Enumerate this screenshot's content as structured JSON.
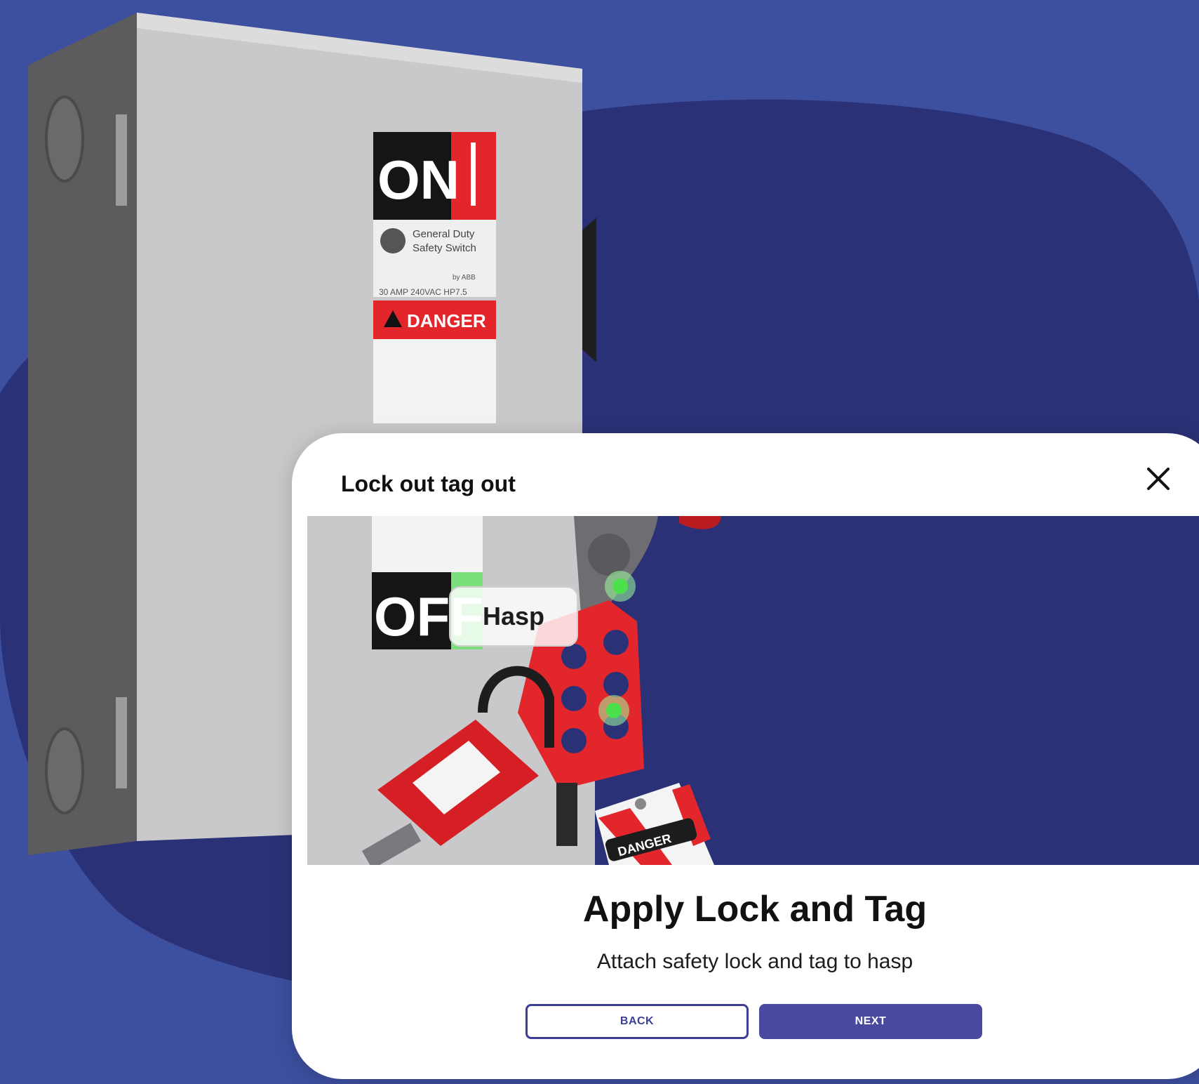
{
  "modal": {
    "title": "Lock out tag out",
    "close_icon": "close-icon"
  },
  "scene": {
    "callout_label": "Hasp",
    "hotspots": [
      "hasp-hotspot",
      "lock-hotspot"
    ]
  },
  "step": {
    "heading": "Apply Lock and Tag",
    "description": "Attach safety lock and tag to hasp"
  },
  "buttons": {
    "back_label": "BACK",
    "next_label": "NEXT"
  },
  "enclosure_label": {
    "on_text": "ON",
    "brand_line1": "General Duty",
    "brand_line2": "Safety Switch",
    "by_text": "by ABB",
    "rating": "30 AMP 240VAC HP7.5",
    "danger_text": "DANGER",
    "off_text": "OFF"
  },
  "tag": {
    "text": "DANGER"
  },
  "padlock": {
    "tag_text": "DANGER"
  },
  "colors": {
    "background": "#3d4f9f",
    "blob": "#2b3176",
    "accent": "#4a49a0",
    "danger_red": "#e3262b",
    "hotspot_green": "#4de04d"
  }
}
